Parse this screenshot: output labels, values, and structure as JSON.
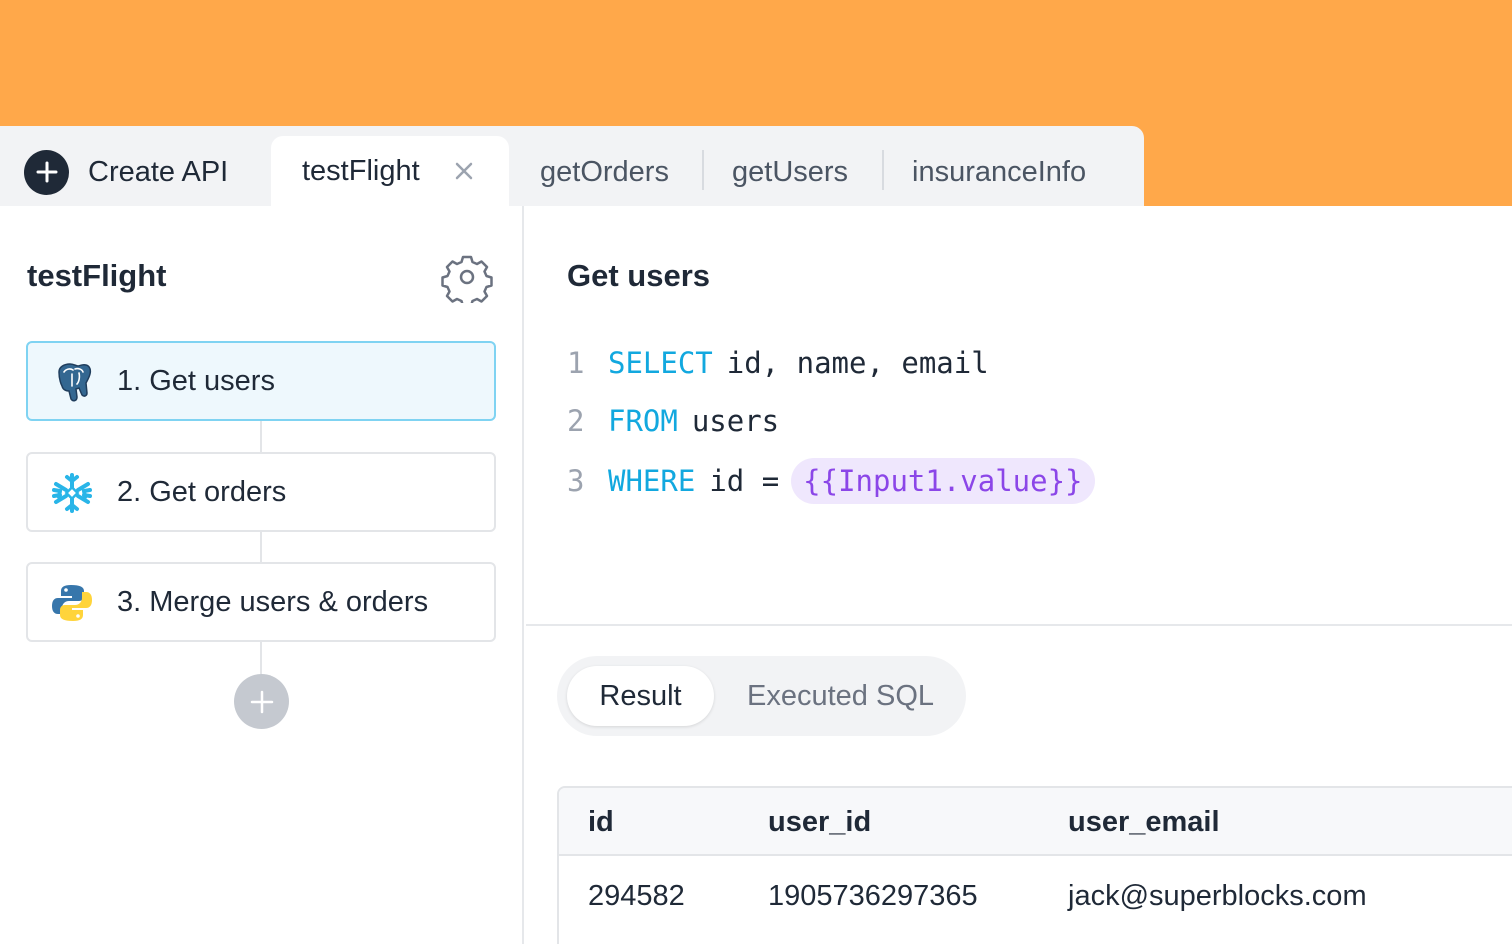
{
  "tabs": {
    "create_label": "Create API",
    "active": "testFlight",
    "others": [
      "getOrders",
      "getUsers",
      "insuranceInfo"
    ]
  },
  "sidebar": {
    "title": "testFlight",
    "steps": [
      {
        "label": "1. Get users",
        "icon": "postgres-icon"
      },
      {
        "label": "2. Get orders",
        "icon": "snowflake-icon"
      },
      {
        "label": "3. Merge users & orders",
        "icon": "python-icon"
      }
    ]
  },
  "editor": {
    "title": "Get users",
    "lines": [
      {
        "num": "1",
        "keyword": "SELECT",
        "text": "id, name, email"
      },
      {
        "num": "2",
        "keyword": "FROM",
        "text": "users"
      },
      {
        "num": "3",
        "keyword": "WHERE",
        "text": "id =",
        "binding": "{{Input1.value}}"
      }
    ]
  },
  "output": {
    "tabs": [
      "Result",
      "Executed SQL"
    ],
    "columns": [
      "id",
      "user_id",
      "user_email"
    ],
    "rows": [
      [
        "294582",
        "1905736297365",
        "jack@superblocks.com"
      ]
    ]
  },
  "colors": {
    "background": "#ffa84a",
    "keyword": "#12a8df",
    "binding": "#8b46e8",
    "active_step_border": "#7fd3f2"
  }
}
